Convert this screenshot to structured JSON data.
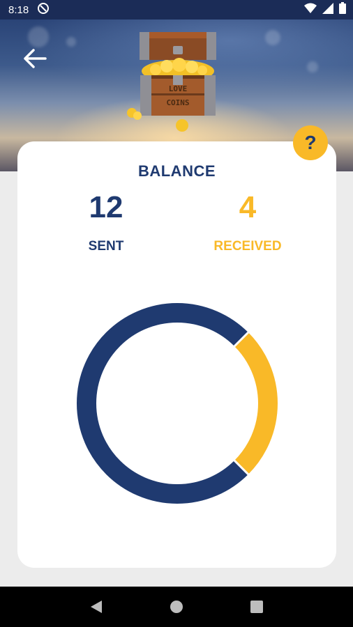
{
  "status_bar": {
    "time": "8:18"
  },
  "header": {
    "chest_line1": "LOVE",
    "chest_line2": "COINS"
  },
  "balance": {
    "title": "BALANCE",
    "sent_value": "12",
    "sent_label": "SENT",
    "received_value": "4",
    "received_label": "RECEIVED",
    "help_label": "?"
  },
  "chart_data": {
    "type": "pie",
    "categories": [
      "SENT",
      "RECEIVED"
    ],
    "values": [
      12,
      4
    ],
    "colors": [
      "#1f3a70",
      "#f9b928"
    ]
  },
  "colors": {
    "navy": "#1f3a70",
    "gold": "#f9b928",
    "status_bar": "#1b2c57"
  },
  "icons": {
    "status": [
      "do-not-disturb-icon",
      "wifi-icon",
      "cell-signal-icon",
      "battery-icon"
    ],
    "nav": [
      "back-triangle-icon",
      "home-circle-icon",
      "recents-square-icon"
    ]
  }
}
